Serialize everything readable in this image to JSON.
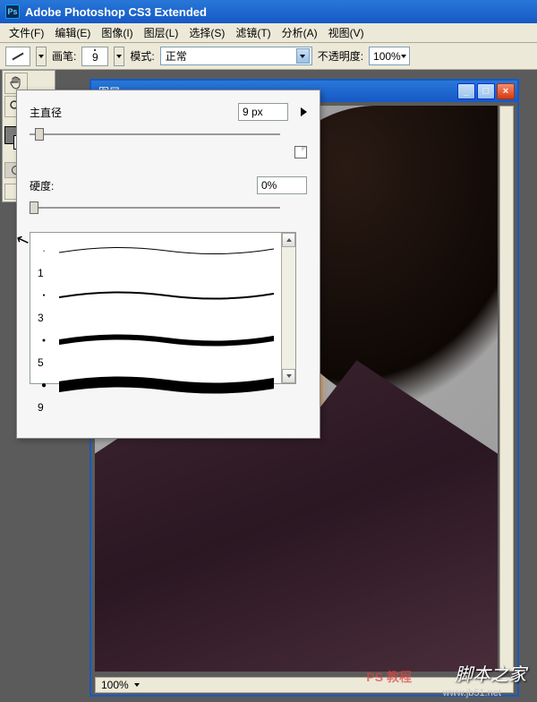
{
  "title": "Adobe Photoshop CS3 Extended",
  "menu": {
    "file": "文件(F)",
    "edit": "编辑(E)",
    "image": "图像(I)",
    "layer": "图层(L)",
    "select": "选择(S)",
    "filter": "滤镜(T)",
    "analysis": "分析(A)",
    "view": "视图(V)"
  },
  "options": {
    "brush_label": "画笔:",
    "brush_size_chip": "9",
    "mode_label": "模式:",
    "mode_value": "正常",
    "opacity_label": "不透明度:",
    "opacity_value": "100%"
  },
  "docwin": {
    "title": "图层 ...",
    "zoom": "100%"
  },
  "brush_popup": {
    "diameter_label": "主直径",
    "diameter_value": "9 px",
    "hardness_label": "硬度:",
    "hardness_value": "0%",
    "presets": [
      {
        "size": "1",
        "weight": 1
      },
      {
        "size": "3",
        "weight": 2
      },
      {
        "size": "5",
        "weight": 5
      },
      {
        "size": "9",
        "weight": 10
      }
    ]
  },
  "watermarks": {
    "w1": "脚本之家",
    "w2": "www.jb51.net",
    "w3": "PS 教程"
  }
}
